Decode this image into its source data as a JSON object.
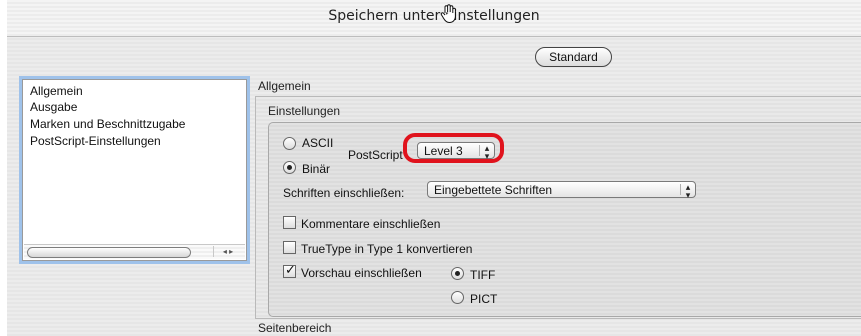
{
  "window": {
    "title": "Speichern unter Einstellungen"
  },
  "toolbar": {
    "standard_label": "Standard"
  },
  "sidebar": {
    "items": [
      {
        "label": "Allgemein"
      },
      {
        "label": "Ausgabe"
      },
      {
        "label": "Marken und Beschnittzugabe"
      },
      {
        "label": "PostScript-Einstellungen"
      }
    ],
    "scroll_arrows": "◂ ▸"
  },
  "main": {
    "section_title": "Allgemein",
    "group_title": "Einstellungen",
    "encoding": {
      "ascii_label": "ASCII",
      "binary_label": "Binär",
      "selected": "Binär"
    },
    "postscript": {
      "label": "PostScript",
      "value": "Level 3"
    },
    "fonts": {
      "label": "Schriften einschließen:",
      "value": "Eingebettete Schriften"
    },
    "include_comments": {
      "label": "Kommentare einschließen",
      "checked": false
    },
    "truetype_convert": {
      "label": "TrueType in Type 1 konvertieren",
      "checked": false
    },
    "preview": {
      "label": "Vorschau einschließen",
      "checked": true,
      "tiff_label": "TIFF",
      "pict_label": "PICT",
      "selected": "TIFF"
    },
    "page_range_title": "Seitenbereich"
  },
  "colors": {
    "highlight": "#e0131d",
    "selection_ring": "#9fc2ea"
  },
  "icons": {
    "cursor": "hand-cursor-icon",
    "popup": "up-down-arrows-icon"
  }
}
